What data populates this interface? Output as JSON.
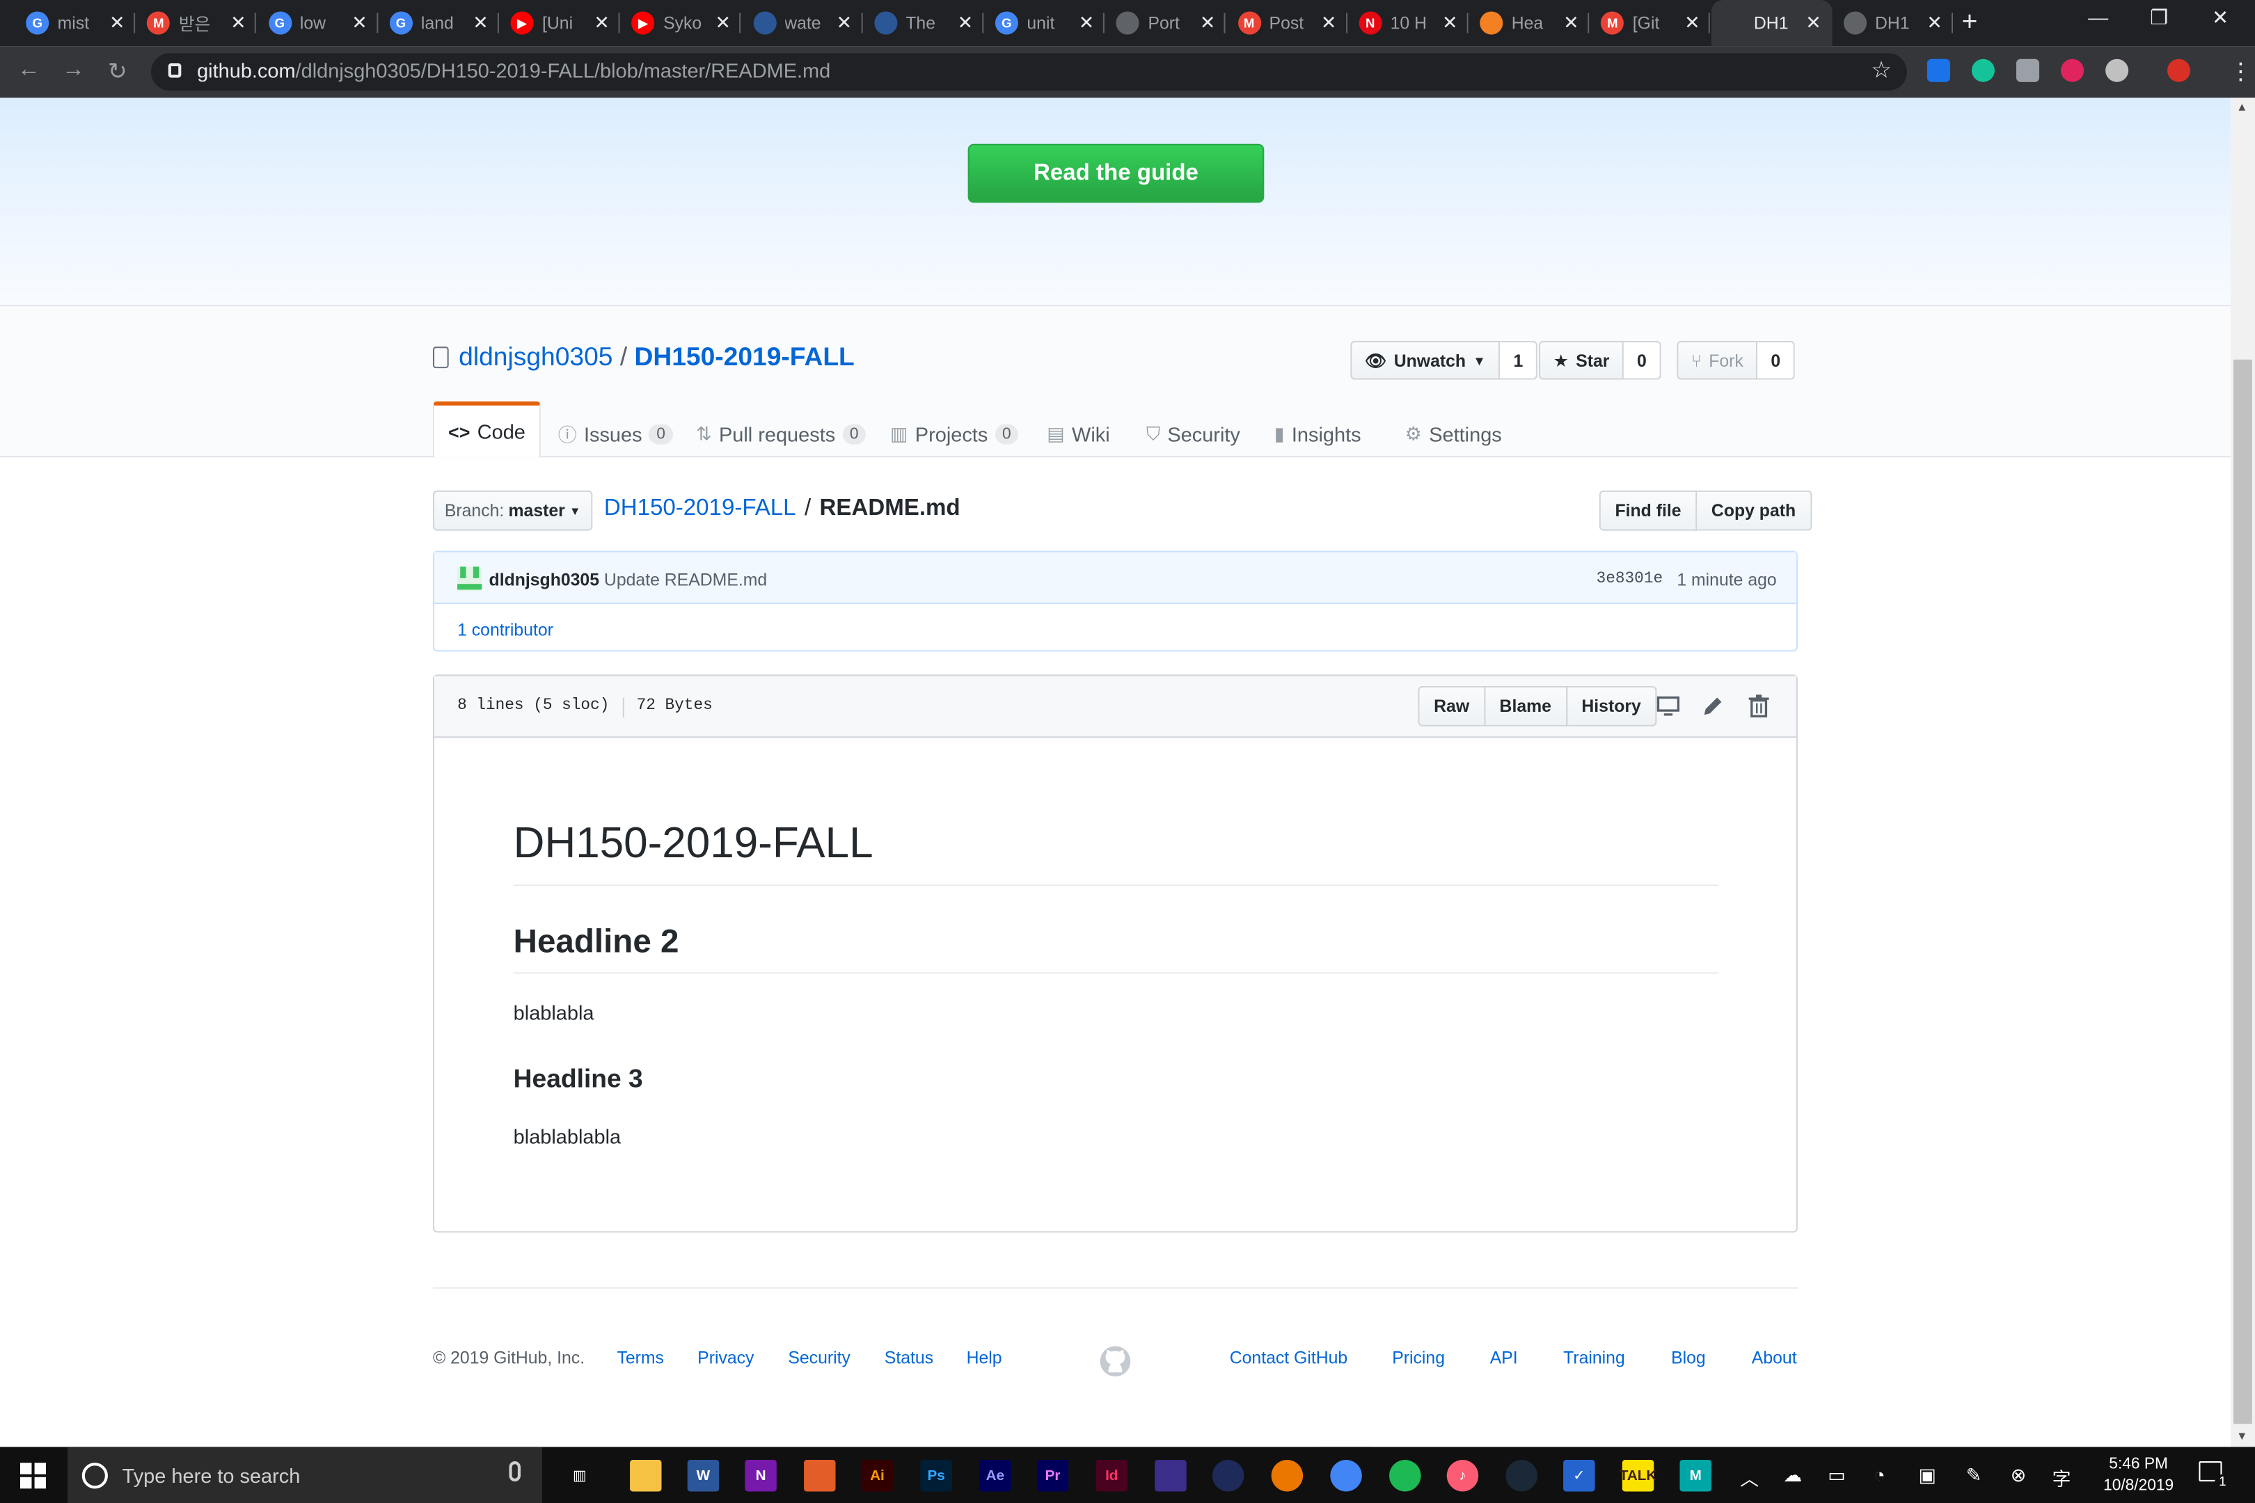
{
  "browser": {
    "tabs": [
      {
        "title": "mist",
        "fav": "G",
        "color": "#4285f4"
      },
      {
        "title": "받은",
        "fav": "M",
        "color": "#ea4335"
      },
      {
        "title": "low",
        "fav": "G",
        "color": "#4285f4"
      },
      {
        "title": "land",
        "fav": "G",
        "color": "#4285f4"
      },
      {
        "title": "[Uni",
        "fav": "▶",
        "color": "#ff0000"
      },
      {
        "title": "Syko",
        "fav": "▶",
        "color": "#ff0000"
      },
      {
        "title": "wate",
        "fav": "",
        "color": "#2b5797"
      },
      {
        "title": "The",
        "fav": "",
        "color": "#2b5797"
      },
      {
        "title": "unit",
        "fav": "G",
        "color": "#4285f4"
      },
      {
        "title": "Port",
        "fav": "",
        "color": "#5f6368"
      },
      {
        "title": "Post",
        "fav": "M",
        "color": "#ea4335"
      },
      {
        "title": "10 H",
        "fav": "N",
        "color": "#e50914"
      },
      {
        "title": "Hea",
        "fav": "",
        "color": "#f48024"
      },
      {
        "title": "[Git",
        "fav": "M",
        "color": "#ea4335"
      },
      {
        "title": "DH1",
        "fav": "",
        "color": "#35363a",
        "active": true
      },
      {
        "title": "DH1",
        "fav": "",
        "color": "#5f6368"
      }
    ],
    "url_host": "github.com",
    "url_path": "/dldnjsgh0305/DH150-2019-FALL/blob/master/README.md"
  },
  "banner": {
    "button": "Read the guide"
  },
  "repo": {
    "owner": "dldnjsgh0305",
    "separator": "/",
    "name": "DH150-2019-FALL",
    "unwatch": "Unwatch",
    "unwatch_count": "1",
    "star": "Star",
    "star_count": "0",
    "fork": "Fork",
    "fork_count": "0"
  },
  "tabs": {
    "code": "Code",
    "issues": "Issues",
    "issues_count": "0",
    "pulls": "Pull requests",
    "pulls_count": "0",
    "projects": "Projects",
    "projects_count": "0",
    "wiki": "Wiki",
    "security": "Security",
    "insights": "Insights",
    "settings": "Settings"
  },
  "filenav": {
    "branch_label": "Branch:",
    "branch": "master",
    "crumb_repo": "DH150-2019-FALL",
    "crumb_sep": "/",
    "crumb_file": "README.md",
    "find_file": "Find file",
    "copy_path": "Copy path"
  },
  "commit": {
    "author": "dldnjsgh0305",
    "message": "Update README.md",
    "sha": "3e8301e",
    "time": "1 minute ago",
    "contributors": "1 contributor"
  },
  "file": {
    "lines": "8 lines (5 sloc)",
    "size": "72 Bytes",
    "raw": "Raw",
    "blame": "Blame",
    "history": "History"
  },
  "readme": {
    "h1": "DH150-2019-FALL",
    "h2": "Headline 2",
    "p1": "blablabla",
    "h3": "Headline 3",
    "p2": "blablablabla"
  },
  "footer": {
    "copyright": "© 2019 GitHub, Inc.",
    "terms": "Terms",
    "privacy": "Privacy",
    "security": "Security",
    "status": "Status",
    "help": "Help",
    "contact": "Contact GitHub",
    "pricing": "Pricing",
    "api": "API",
    "training": "Training",
    "blog": "Blog",
    "about": "About"
  },
  "taskbar": {
    "search_placeholder": "Type here to search",
    "time": "5:46 PM",
    "date": "10/8/2019",
    "notifications": "1"
  }
}
